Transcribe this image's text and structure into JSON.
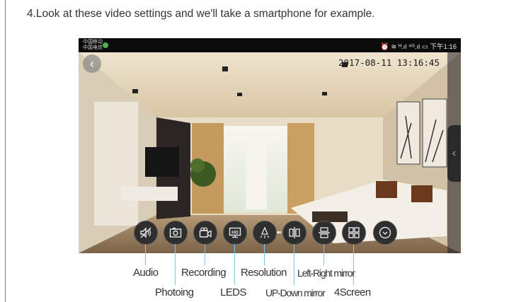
{
  "instruction": "4.Look at these video settings and we'll take a smartphone for example.",
  "status_bar": {
    "carrier_line1": "中国移动",
    "carrier_line2": "中国电信",
    "right_text": "⏰ ≋ ᴴ.ıl ⁴ᴳ.ıl ▭ 下午1:16"
  },
  "video": {
    "timestamp": "2017-08-11 13:16:45",
    "back_glyph": "‹",
    "side_tab_glyph": "‹"
  },
  "controls": [
    {
      "name": "audio-mute-icon"
    },
    {
      "name": "camera-icon"
    },
    {
      "name": "video-camera-icon"
    },
    {
      "name": "hd-icon"
    },
    {
      "name": "light-bulb-icon"
    },
    {
      "name": "flip-horizontal-icon"
    },
    {
      "name": "flip-vertical-icon"
    },
    {
      "name": "grid-icon"
    },
    {
      "name": "chevron-down-circle-icon"
    }
  ],
  "callouts": {
    "audio": "Audio",
    "photoing": "Photoing",
    "recording": "Recording",
    "leds": "LEDS",
    "resolution": "Resolution",
    "up_down_mirror": "UP-Down mirror",
    "left_right_mirror": "Left-Right mirror",
    "four_screen": "4Screen"
  },
  "colors": {
    "leader_line": "#7fc3e6",
    "control_bg": "#2e2e2e"
  }
}
